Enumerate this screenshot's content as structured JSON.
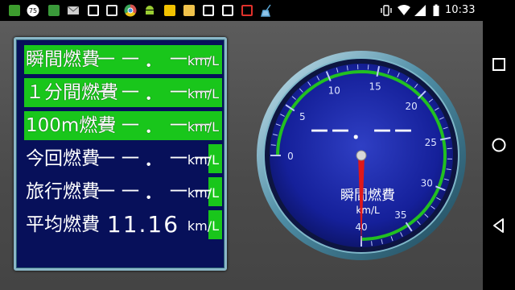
{
  "status_bar": {
    "notification_badge": "75",
    "time": "10:33",
    "left_icons": [
      "app-bus-icon",
      "badge-75-icon",
      "app-car-icon",
      "mail-icon",
      "chart-app-icon",
      "m-app-icon",
      "chrome-icon",
      "android-icon",
      "emoji-icon",
      "folder-icon",
      "image-icon",
      "m-app-icon",
      "news-icon",
      "broom-icon"
    ],
    "right_icons": [
      "vibrate-icon",
      "wifi-icon",
      "signal-icon",
      "battery-icon"
    ]
  },
  "panel": {
    "rows": [
      {
        "label": "瞬間燃費",
        "value": "－－．－－",
        "unit": "km/L",
        "bar_level": 1.0
      },
      {
        "label": "１分間燃費",
        "value": "－－．－－",
        "unit": "km/L",
        "bar_level": 1.0
      },
      {
        "label": "100m燃費",
        "value": "－－．－－",
        "unit": "km/L",
        "bar_level": 1.0
      },
      {
        "label": "今回燃費",
        "value": "－－．－－",
        "unit": "km/L",
        "bar_level": 0.07
      },
      {
        "label": "旅行燃費",
        "value": "－－．－－",
        "unit": "km/L",
        "bar_level": 0.07
      },
      {
        "label": "平均燃費",
        "value": "11.16",
        "unit": "km/L",
        "bar_level": 0.07
      }
    ]
  },
  "gauge": {
    "title": "瞬間燃費",
    "unit": "km/L",
    "readout": "－－．－－",
    "ticks": [
      "0",
      "5",
      "10",
      "15",
      "20",
      "25",
      "30",
      "35",
      "40"
    ],
    "needle_value": 40,
    "arc_color": "#22c022",
    "needle_color": "#e01818"
  },
  "nav": {
    "buttons": [
      "recents-button",
      "home-button",
      "back-button"
    ]
  }
}
